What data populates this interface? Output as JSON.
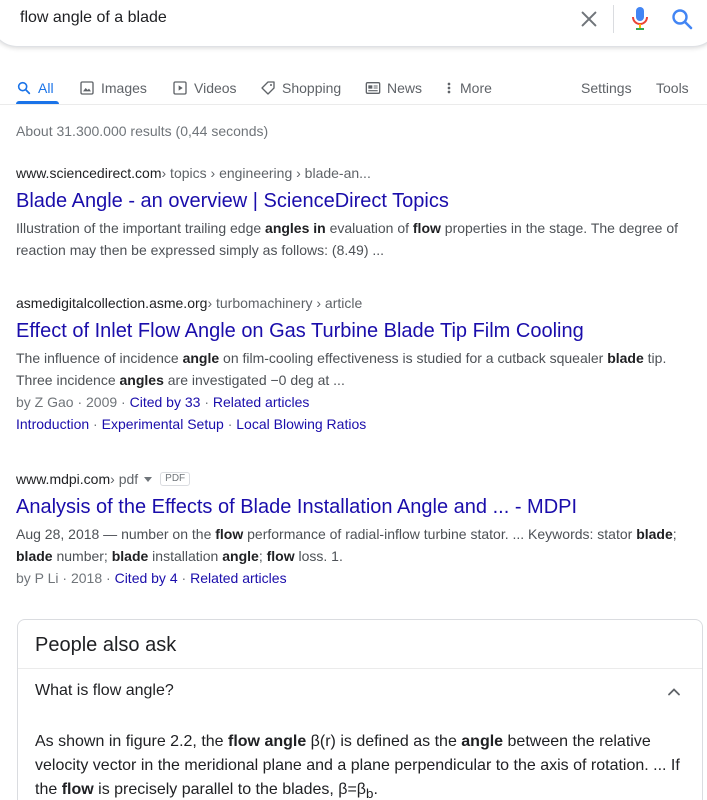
{
  "search": {
    "query": "flow angle of a blade"
  },
  "tabs": [
    {
      "label": "All",
      "icon": "search-icon"
    },
    {
      "label": "Images",
      "icon": "image-icon"
    },
    {
      "label": "Videos",
      "icon": "video-icon"
    },
    {
      "label": "Shopping",
      "icon": "tag-icon"
    },
    {
      "label": "News",
      "icon": "news-icon"
    },
    {
      "label": "More",
      "icon": "more-vert-icon"
    }
  ],
  "tools": {
    "settings": "Settings",
    "tools": "Tools"
  },
  "stats": "About 31.300.000 results (0,44 seconds)",
  "results": [
    {
      "domain": "www.sciencedirect.com",
      "path": " › topics › engineering › blade-an...",
      "title": "Blade Angle - an overview | ScienceDirect Topics",
      "snippet_parts": [
        "Illustration of the important trailing edge ",
        "angles in",
        " evaluation of ",
        "flow",
        " properties in the stage. The degree of reaction may then be expressed simply as follows: (8.49) ..."
      ]
    },
    {
      "domain": "asmedigitalcollection.asme.org",
      "path": " › turbomachinery › article",
      "title": "Effect of Inlet Flow Angle on Gas Turbine Blade Tip Film Cooling",
      "snippet_parts": [
        "The influence of incidence ",
        "angle",
        " on film-cooling effectiveness is studied for a cutback squealer ",
        "blade",
        " tip. Three incidence ",
        "angles",
        " are investigated −0 deg at ..."
      ],
      "meta_prefix": "by Z Gao · 2009 · ",
      "cited": "Cited by 33",
      "sep": " · ",
      "related": "Related articles",
      "sitelinks": [
        "Introduction",
        "Experimental Setup",
        "Local Blowing Ratios"
      ],
      "sitelink_sep": " · "
    },
    {
      "domain": "www.mdpi.com",
      "path": " › pdf",
      "badge": "PDF",
      "title": "Analysis of the Effects of Blade Installation Angle and ... - MDPI",
      "snippet_parts": [
        "Aug 28, 2018 — number on the ",
        "flow",
        " performance of radial-inflow turbine stator. ... Keywords: stator ",
        "blade",
        "; ",
        "blade",
        " number; ",
        "blade",
        " installation ",
        "angle",
        "; ",
        "flow",
        " loss. 1."
      ],
      "meta_prefix": "by P Li · 2018 · ",
      "cited": "Cited by 4",
      "sep": " · ",
      "related": "Related articles"
    }
  ],
  "paa": {
    "heading": "People also ask",
    "question": "What is flow angle?",
    "answer_parts": [
      "As shown in figure 2.2, the ",
      "flow angle",
      " β(r) is defined as the ",
      "angle",
      " between the relative velocity vector in the meridional plane and a plane perpendicular to the axis of rotation. ... If the ",
      "flow",
      " is precisely parallel to the blades, β=β",
      "b",
      "."
    ]
  },
  "colors": {
    "link": "#1a0dab",
    "accent": "#1a73e8",
    "mic_blue": "#4285f4",
    "mic_red": "#ea4335",
    "mic_yellow": "#fbbc04",
    "mic_green": "#34a853"
  }
}
